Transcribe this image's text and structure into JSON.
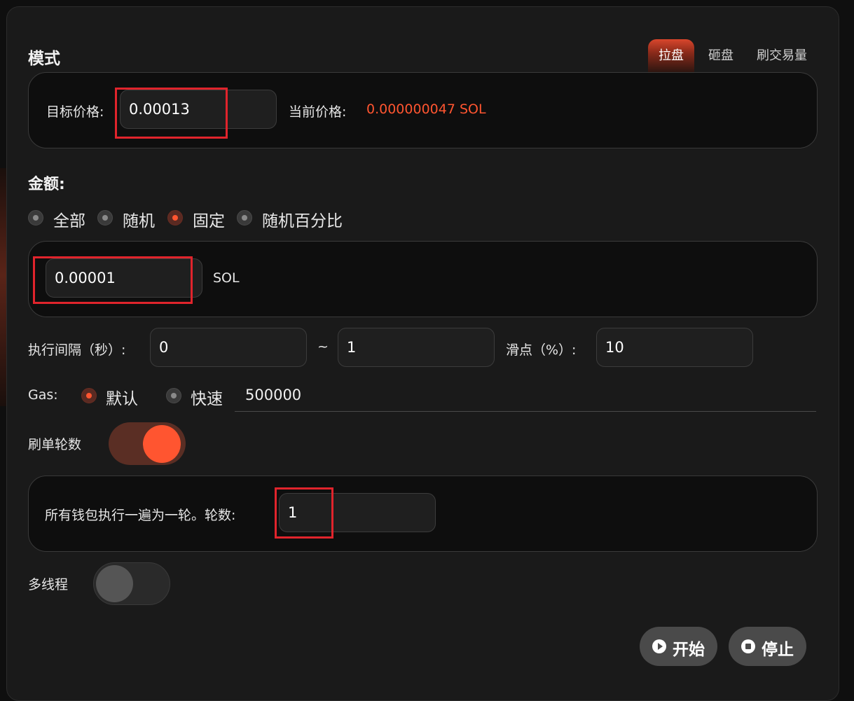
{
  "mode": {
    "title": "模式",
    "tabs": [
      {
        "label": "拉盘",
        "active": true
      },
      {
        "label": "砸盘",
        "active": false
      },
      {
        "label": "刷交易量",
        "active": false
      }
    ],
    "target_price_label": "目标价格:",
    "target_price_value": "0.00013",
    "current_price_label": "当前价格:",
    "current_price_value": "0.000000047 SOL"
  },
  "amount": {
    "title": "金额:",
    "options": [
      {
        "label": "全部",
        "selected": false
      },
      {
        "label": "随机",
        "selected": false
      },
      {
        "label": "固定",
        "selected": true
      },
      {
        "label": "随机百分比",
        "selected": false
      }
    ],
    "value": "0.00001",
    "unit": "SOL"
  },
  "interval": {
    "label": "执行间隔（秒）:",
    "min": "0",
    "sep": "~",
    "max": "1",
    "slippage_label": "滑点（%）:",
    "slippage": "10"
  },
  "gas": {
    "label": "Gas:",
    "options": [
      {
        "label": "默认",
        "selected": true
      },
      {
        "label": "快速",
        "selected": false
      }
    ],
    "value": "500000"
  },
  "rounds": {
    "label": "刷单轮数",
    "enabled": true,
    "desc": "所有钱包执行一遍为一轮。轮数:",
    "value": "1"
  },
  "multithread": {
    "label": "多线程",
    "enabled": false
  },
  "actions": {
    "start_label": "开始",
    "start_icon": "play-circle-icon",
    "stop_label": "停止",
    "stop_icon": "stop-circle-icon"
  },
  "colors": {
    "accent": "#ff5530",
    "price_text": "#ff5530",
    "highlight_box": "#e0242c"
  }
}
